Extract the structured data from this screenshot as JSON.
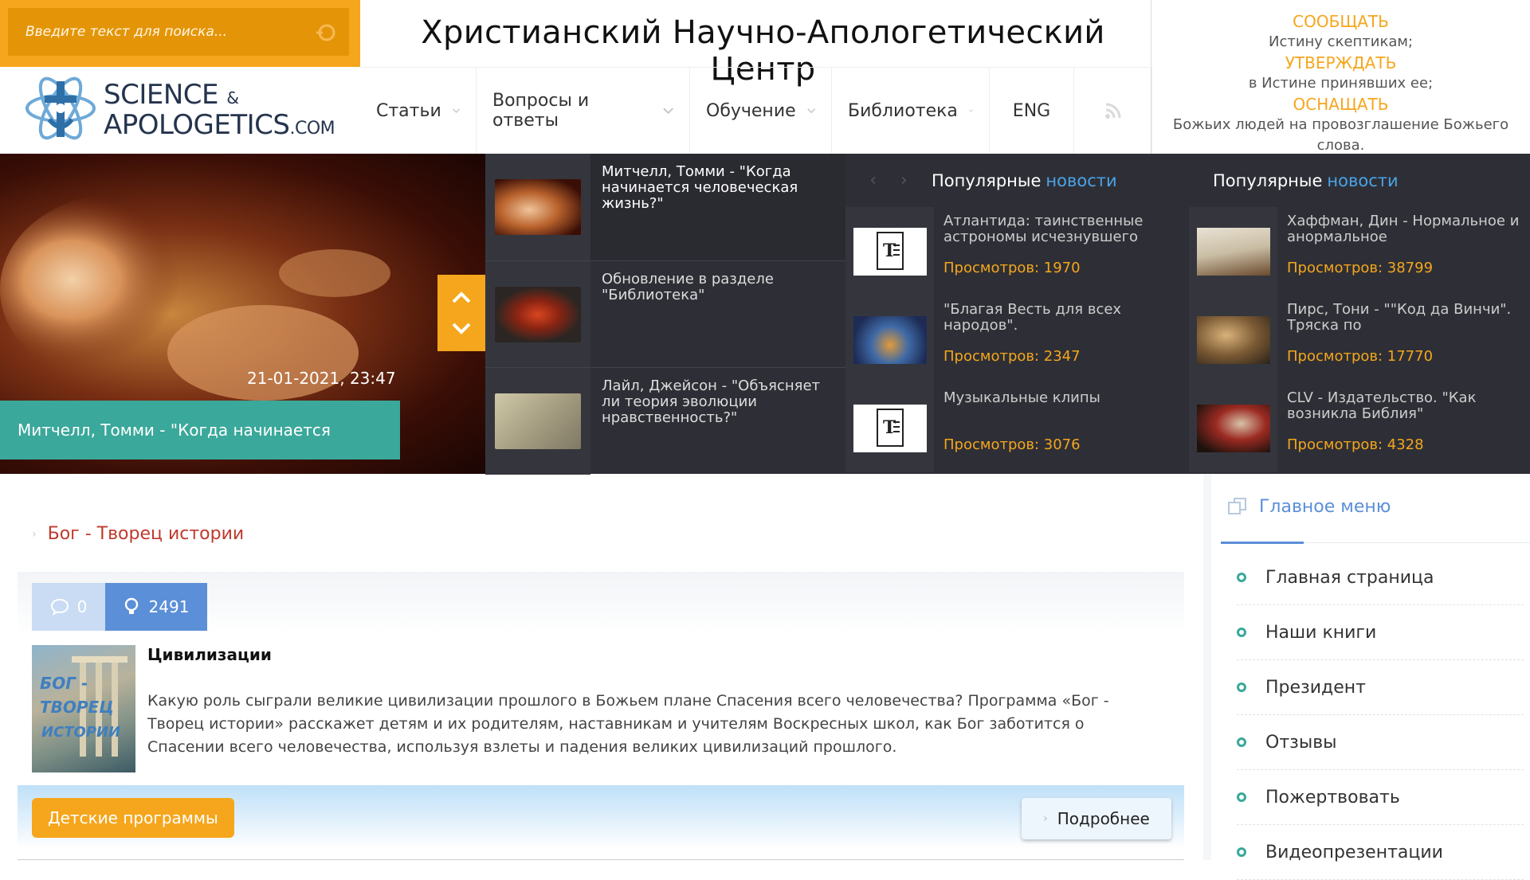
{
  "header": {
    "search_placeholder": "Введите текст для поиска...",
    "site_title": "Христианский Научно-Апологетический Центр",
    "logo": {
      "line1": "SCIENCE",
      "amp": "&",
      "line2": "APOLOGETICS",
      "suffix": ".COM"
    },
    "nav": [
      {
        "label": "Статьи",
        "has_dropdown": true
      },
      {
        "label": "Вопросы и ответы",
        "has_dropdown": true
      },
      {
        "label": "Обучение",
        "has_dropdown": true
      },
      {
        "label": "Библиотека",
        "has_dropdown": true
      },
      {
        "label": "ENG",
        "has_dropdown": false
      }
    ],
    "motto": [
      {
        "highlight": "СООБЩАТЬ",
        "text": "Истину скептикам;"
      },
      {
        "highlight": "УТВЕРЖДАТЬ",
        "text": "в Истине принявших ее;"
      },
      {
        "highlight": "ОСНАЩАТЬ",
        "text": "Божьих людей на провозглашение Божьего слова."
      }
    ]
  },
  "slider": {
    "date": "21-01-2021, 23:47",
    "caption": "Митчелл, Томми - \"Когда начинается",
    "thumbs": [
      {
        "title": "Митчелл, Томми - \"Когда начинается человеческая жизнь?\""
      },
      {
        "title": "Обновление в разделе \"Библиотека\""
      },
      {
        "title": "Лайл, Джейсон - \"Объясняет ли теория эволюции нравственность?\""
      }
    ]
  },
  "popular": {
    "heading_prefix": "Популярные",
    "heading_accent": "новости",
    "col1": [
      {
        "title": "Атлантида: таинственные астрономы исчезнувшего",
        "views": "Просмотров: 1970"
      },
      {
        "title": "\"Благая Весть для всех народов\".",
        "views": "Просмотров: 2347"
      },
      {
        "title": "Музыкальные клипы",
        "views": "Просмотров: 3076"
      }
    ],
    "col2": [
      {
        "title": "Хаффман, Дин - Нормальное и анормальное",
        "views": "Просмотров: 38799"
      },
      {
        "title": "Пирс, Тони - \"\"Код да Винчи\". Тряска по",
        "views": "Просмотров: 17770"
      },
      {
        "title": "CLV - Издательство. \"Как возникла Библия\"",
        "views": "Просмотров: 4328"
      }
    ]
  },
  "post": {
    "breadcrumb": "Бог - Творец истории",
    "comments": "0",
    "views": "2491",
    "title": "Цивилизации",
    "text": "Какую роль сыграли великие цивилизации прошлого в Божьем плане Спасения всего человечества? Программа «Бог - Творец истории» расскажет детям и их родителям, наставникам и учителям Воскресных школ, как Бог заботится о Спасении всего человечества, используя взлеты и падения великих цивилизаций прошлого.",
    "category": "Детские программы",
    "more": "Подробнее"
  },
  "sidebar": {
    "title": "Главное меню",
    "items": [
      "Главная страница",
      "Наши книги",
      "Президент",
      "Отзывы",
      "Пожертвовать",
      "Видеопрезентации"
    ]
  },
  "colors": {
    "accent_orange": "#f5a61c",
    "teal": "#3aa89a",
    "blue": "#5b8fd8",
    "dark": "#2e2f36"
  }
}
